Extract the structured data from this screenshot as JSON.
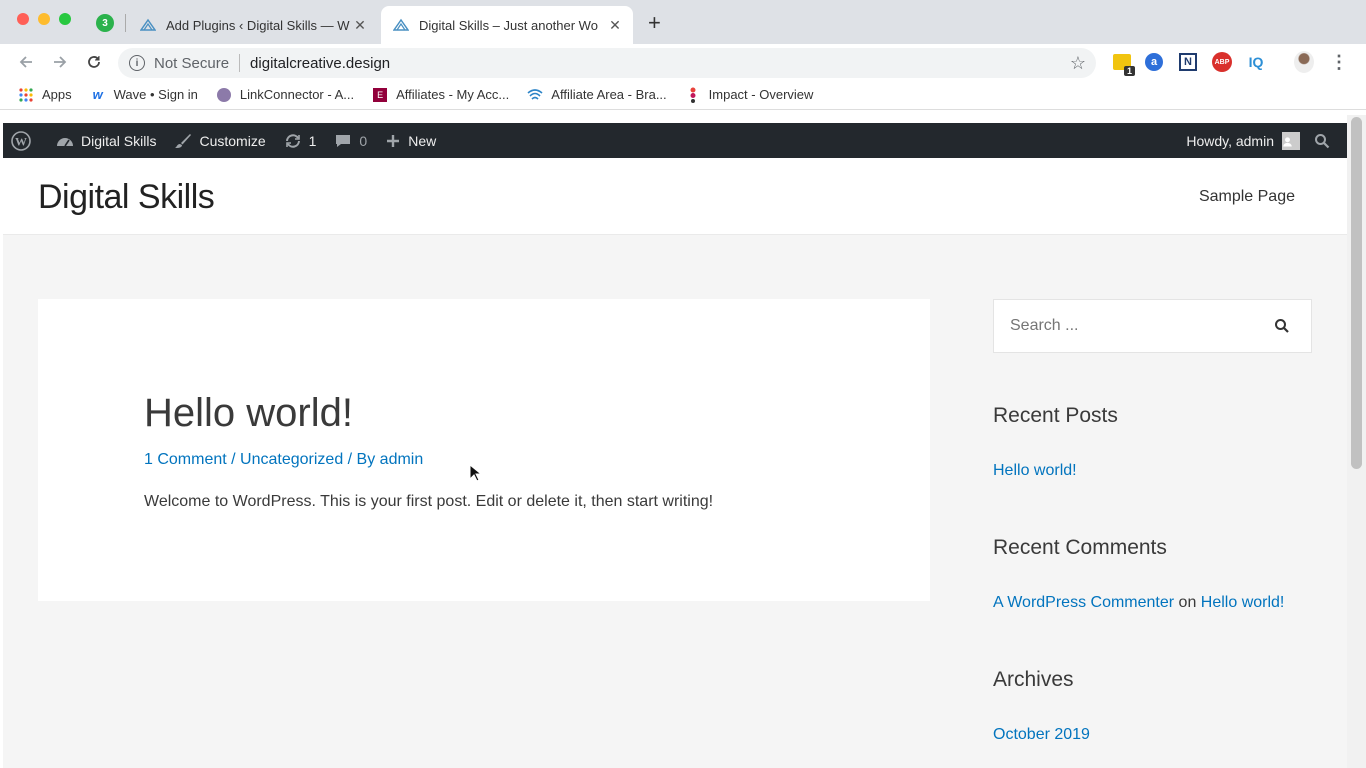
{
  "browser": {
    "tabs": [
      {
        "badge": "3"
      },
      {
        "title": "Add Plugins ‹ Digital Skills — W"
      },
      {
        "title": "Digital Skills – Just another Wo"
      }
    ],
    "new_tab": "+",
    "security_label": "Not Secure",
    "url": "digitalcreative.design",
    "extension_badge": "1",
    "extensions": [
      "a",
      "N",
      "ABP",
      "IQ"
    ],
    "bookmarks": [
      {
        "label": "Apps",
        "icon": "apps-grid-icon"
      },
      {
        "label": "Wave • Sign in",
        "icon": "wave-icon"
      },
      {
        "label": "LinkConnector - A...",
        "icon": "linkconnector-icon"
      },
      {
        "label": "Affiliates - My Acc...",
        "icon": "elementor-icon"
      },
      {
        "label": "Affiliate Area - Bra...",
        "icon": "affiliate-icon"
      },
      {
        "label": "Impact - Overview",
        "icon": "impact-icon"
      }
    ]
  },
  "adminbar": {
    "site_name": "Digital Skills",
    "customize": "Customize",
    "updates_count": "1",
    "comments_count": "0",
    "new_label": "New",
    "howdy": "Howdy, admin"
  },
  "site": {
    "title": "Digital Skills",
    "menu_item": "Sample Page"
  },
  "post": {
    "title": "Hello world!",
    "meta_comments": "1 Comment",
    "meta_sep1": " / ",
    "meta_category": "Uncategorized",
    "meta_sep2": " / By ",
    "meta_author": "admin",
    "excerpt": "Welcome to WordPress. This is your first post. Edit or delete it, then start writing!"
  },
  "sidebar": {
    "search_placeholder": "Search ...",
    "recent_posts_title": "Recent Posts",
    "recent_post_1": "Hello world!",
    "recent_comments_title": "Recent Comments",
    "comment_author": "A WordPress Commenter",
    "comment_on": " on ",
    "comment_post": "Hello world!",
    "archives_title": "Archives",
    "archive_1": "October 2019"
  }
}
